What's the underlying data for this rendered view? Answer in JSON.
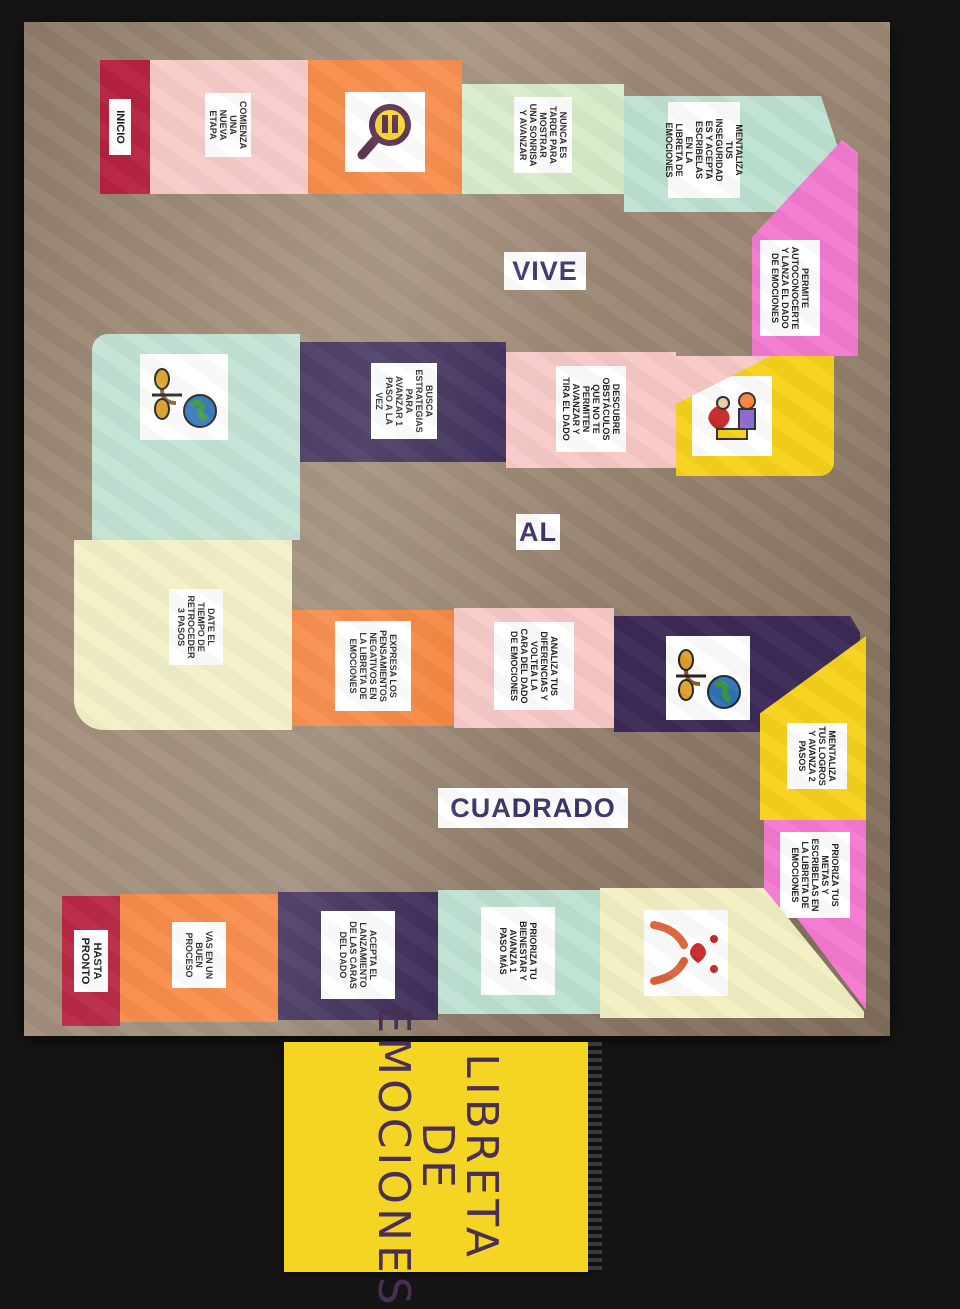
{
  "board": {
    "title_words": [
      "VIVE",
      "AL",
      "CUADRADO"
    ],
    "start": "INICIO",
    "end": "HASTA\nPRONTO",
    "squares": [
      {
        "text": "COMIENZA\nUNA\nNUEVA\nETAPA"
      },
      {
        "icon": "magnifier-icon"
      },
      {
        "text": "NUNCA ES\nTARDE PARA\nMOSTRAR\nUNA SONRISA\nY AVANZAR"
      },
      {
        "text": "MENTALIZA\nTUS\nINSEGURIDAD\nES Y ACEPTA\nESCRIBELAS\nEN LA\nLIBRETA DE\nEMOCIONES"
      },
      {
        "text": "PERMITE\nAUTOCONOCERTE\nY LANZA EL DADO\nDE EMOCIONES"
      },
      {
        "icon": "people-heart-icon"
      },
      {
        "text": "DESCUBRE\nOBSTÁCULOS\nQUE NO TE\nPERMITEN\nAVANZAR Y\nTIRA EL DADO"
      },
      {
        "text": "BUSCA\nESTRATEGIAS\nPARA\nAVANZAR 1\nPASO A LA\nVEZ"
      },
      {
        "icon": "world-growth-icon"
      },
      {
        "text": "DATE EL\nTIEMPO DE\nRETROCEDER\n3 PASOS"
      },
      {
        "text": "EXPRESA LOS\nPENSAMIENTOS\nNEGATIVOS EN\nLA LIBRETA DE\nEMOCIONES"
      },
      {
        "text": "ANALIZA TUS\nDIFERENCIAS Y\nVOLTEA LA\nCARA DEL DADO\nDE EMOCIONES"
      },
      {
        "icon": "world-growth-icon"
      },
      {
        "text": "MENTALIZA\nTUS LOGROS\nY AVANZA 2\nPASOS"
      },
      {
        "text": "PRIORIZA TUS\nMETAS Y\nESCRIBELAS EN\nLA LIBRETA DE\nEMOCIONES"
      },
      {
        "icon": "hands-heart-icon"
      },
      {
        "text": "PRIORIZA TU\nBIENESTAR Y\nAVANZA 1\nPASO MÁS"
      },
      {
        "text": "ACEPTA EL\nLANZAMIENTO\nDE LAS CARAS\nDEL DADO"
      },
      {
        "text": "VAS EN UN\nBUEN\nPROCESO"
      }
    ]
  },
  "notebook": {
    "title_lines": [
      "LIBRETA",
      "DE",
      "EMOCIONES"
    ]
  },
  "colors": {
    "red": "#b51b3a",
    "pink": "#f8c9c6",
    "orange": "#f7823a",
    "green": "#d6ebc7",
    "mint": "#bfe2d3",
    "magenta": "#f47ad1",
    "yellow": "#f7d21c",
    "purple": "#3b2a57",
    "cream": "#f3f0c4"
  }
}
